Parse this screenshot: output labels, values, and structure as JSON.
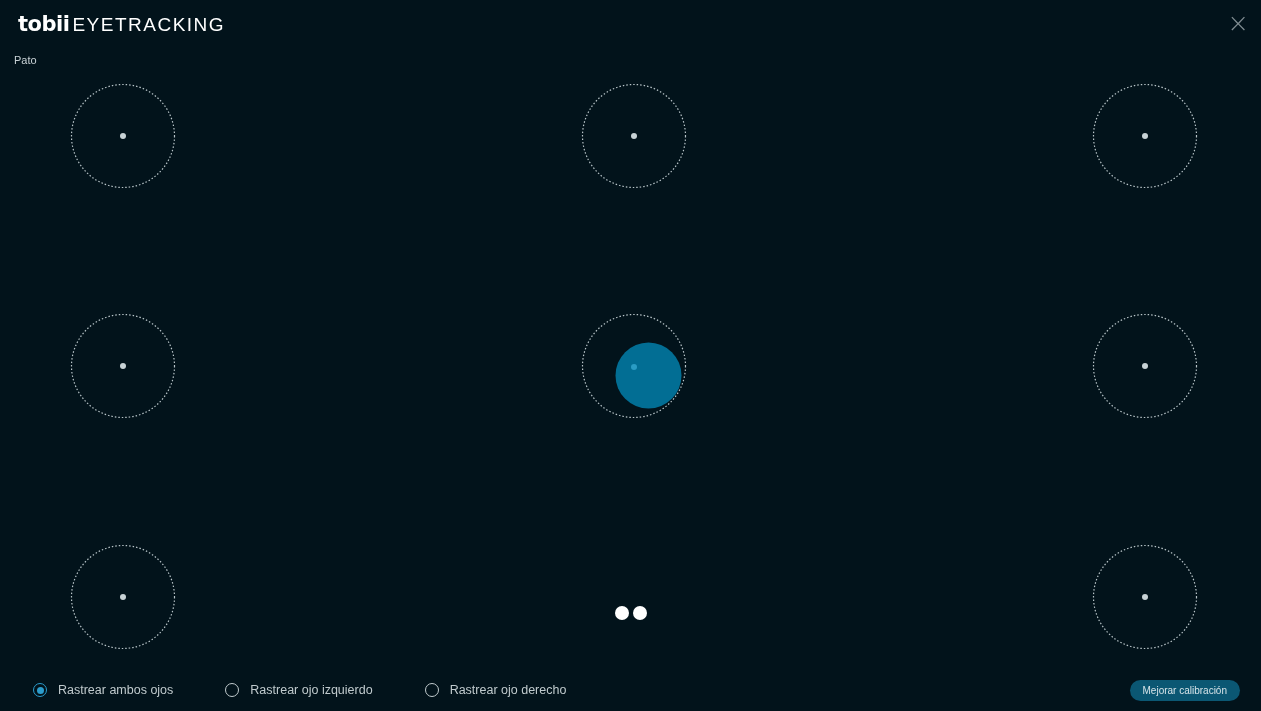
{
  "logo": {
    "brand": "tobii",
    "product": "EYETRACKING"
  },
  "profile": "Pato",
  "close": "×",
  "tracking_options": [
    {
      "label": "Rastrear ambos ojos",
      "selected": true
    },
    {
      "label": "Rastrear ojo izquierdo",
      "selected": false
    },
    {
      "label": "Rastrear ojo derecho",
      "selected": false
    }
  ],
  "improve_button": "Mejorar calibración"
}
